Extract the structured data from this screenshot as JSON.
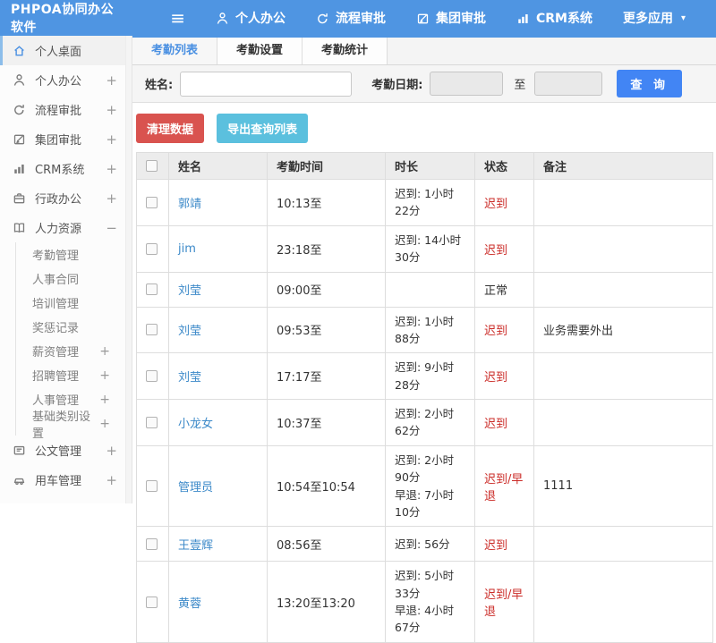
{
  "colors": {
    "topbar": "#4f95e2",
    "accent": "#4285f4",
    "link": "#3d8ac9",
    "danger_text": "#cb2b27",
    "btn_clean": "#d9534f",
    "btn_export": "#5bc0de"
  },
  "topbar": {
    "brand": "PHPOA协同办公软件",
    "menu_icon": "≡",
    "items": [
      {
        "label": "个人办公"
      },
      {
        "label": "流程审批"
      },
      {
        "label": "集团审批"
      },
      {
        "label": "CRM系统"
      },
      {
        "label": "更多应用",
        "caret": "▾"
      }
    ]
  },
  "sidebar": {
    "items": [
      {
        "label": "个人桌面",
        "expand": ""
      },
      {
        "label": "个人办公",
        "expand": "+"
      },
      {
        "label": "流程审批",
        "expand": "+"
      },
      {
        "label": "集团审批",
        "expand": "+"
      },
      {
        "label": "CRM系统",
        "expand": "+"
      },
      {
        "label": "行政办公",
        "expand": "+"
      },
      {
        "label": "人力资源",
        "expand": "−"
      }
    ],
    "hr_submenu": [
      {
        "label": "考勤管理",
        "expand": ""
      },
      {
        "label": "人事合同",
        "expand": ""
      },
      {
        "label": "培训管理",
        "expand": ""
      },
      {
        "label": "奖惩记录",
        "expand": ""
      },
      {
        "label": "薪资管理",
        "expand": "+"
      },
      {
        "label": "招聘管理",
        "expand": "+"
      },
      {
        "label": "人事管理",
        "expand": "+"
      },
      {
        "label": "基础类别设置",
        "expand": "+"
      }
    ],
    "bottom_items": [
      {
        "label": "公文管理",
        "expand": "+"
      },
      {
        "label": "用车管理",
        "expand": "+"
      }
    ]
  },
  "tabs": [
    {
      "label": "考勤列表"
    },
    {
      "label": "考勤设置"
    },
    {
      "label": "考勤统计"
    }
  ],
  "filter": {
    "name_label": "姓名:",
    "date_label": "考勤日期:",
    "to_label": "至",
    "search_button": "查 询"
  },
  "actions": {
    "clean_button": "清理数据",
    "export_button": "导出查询列表"
  },
  "table": {
    "headers": [
      "姓名",
      "考勤时间",
      "时长",
      "状态",
      "备注"
    ],
    "rows": [
      {
        "name": "郭靖",
        "time": "10:13至",
        "duration1": "迟到: 1小时22分",
        "duration2": "",
        "status": "迟到",
        "remark": ""
      },
      {
        "name": "jim",
        "time": "23:18至",
        "duration1": "迟到: 14小时30分",
        "duration2": "",
        "status": "迟到",
        "remark": ""
      },
      {
        "name": "刘莹",
        "time": "09:00至",
        "duration1": "",
        "duration2": "",
        "status": "正常",
        "remark": ""
      },
      {
        "name": "刘莹",
        "time": "09:53至",
        "duration1": "迟到: 1小时88分",
        "duration2": "",
        "status": "迟到",
        "remark": "业务需要外出"
      },
      {
        "name": "刘莹",
        "time": "17:17至",
        "duration1": "迟到: 9小时28分",
        "duration2": "",
        "status": "迟到",
        "remark": ""
      },
      {
        "name": "小龙女",
        "time": "10:37至",
        "duration1": "迟到: 2小时62分",
        "duration2": "",
        "status": "迟到",
        "remark": ""
      },
      {
        "name": "管理员",
        "time": "10:54至10:54",
        "duration1": "迟到: 2小时90分",
        "duration2": "早退: 7小时10分",
        "status": "迟到/早退",
        "remark": "1111"
      },
      {
        "name": "王壹辉",
        "time": "08:56至",
        "duration1": "迟到: 56分",
        "duration2": "",
        "status": "迟到",
        "remark": ""
      },
      {
        "name": "黄蓉",
        "time": "13:20至13:20",
        "duration1": "迟到: 5小时33分",
        "duration2": "早退: 4小时67分",
        "status": "迟到/早退",
        "remark": ""
      }
    ]
  }
}
